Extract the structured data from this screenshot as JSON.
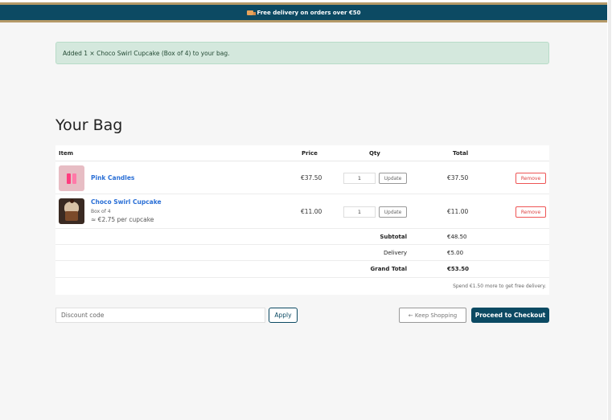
{
  "promo": {
    "text": "Free delivery on orders over €50",
    "icon": "truck-icon"
  },
  "alert": {
    "text": "Added 1 × Choco Swirl Cupcake (Box of 4) to your bag."
  },
  "page": {
    "title": "Your Bag"
  },
  "cart": {
    "headers": {
      "item": "Item",
      "price": "Price",
      "qty": "Qty",
      "total": "Total"
    },
    "items": [
      {
        "name": "Pink Candles",
        "price": "€37.50",
        "qty": "1",
        "total": "€37.50",
        "update_label": "Update",
        "remove_label": "Remove"
      },
      {
        "name": "Choco Swirl Cupcake",
        "variant": "Box of 4",
        "per_unit": "≈ €2.75 per cupcake",
        "price": "€11.00",
        "qty": "1",
        "total": "€11.00",
        "update_label": "Update",
        "remove_label": "Remove"
      }
    ],
    "summary": {
      "subtotal_label": "Subtotal",
      "subtotal": "€48.50",
      "delivery_label": "Delivery",
      "delivery": "€5.00",
      "grand_total_label": "Grand Total",
      "grand_total": "€53.50"
    },
    "hint": "Spend €1.50 more to get free delivery."
  },
  "actions": {
    "discount_placeholder": "Discount code",
    "apply_label": "Apply",
    "keep_shopping_label": "← Keep Shopping",
    "checkout_label": "Proceed to Checkout"
  },
  "colors": {
    "brand": "#0c4a63",
    "accent_border": "#b59a68",
    "success_bg": "#d4e8dd",
    "link": "#2a6fd6",
    "danger": "#dd4444"
  }
}
